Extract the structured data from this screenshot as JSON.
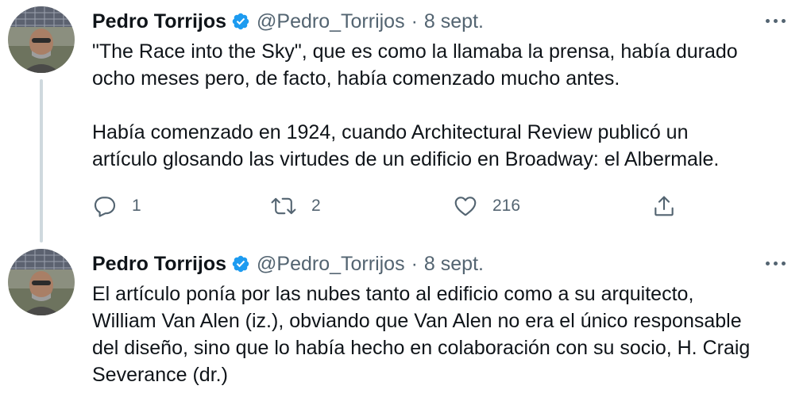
{
  "tweets": [
    {
      "author": {
        "name": "Pedro Torrijos",
        "handle": "@Pedro_Torrijos",
        "verified": true
      },
      "separator": "·",
      "date": "8 sept.",
      "text_lines": [
        "\"The Race into the Sky\", que es como la llamaba la prensa, había durado",
        "ocho meses pero, de facto, había comenzado mucho antes.",
        "Había comenzado en 1924, cuando Architectural Review publicó un",
        "artículo glosando las virtudes de un edificio en Broadway: el Albermale."
      ],
      "actions": {
        "replies": "1",
        "retweets": "2",
        "likes": "216"
      }
    },
    {
      "author": {
        "name": "Pedro Torrijos",
        "handle": "@Pedro_Torrijos",
        "verified": true
      },
      "separator": "·",
      "date": "8 sept.",
      "text_lines": [
        "El artículo ponía por las nubes tanto al edificio como a su arquitecto,",
        "William Van Alen (iz.), obviando que Van Alen no era el único responsable",
        "del diseño, sino que lo había hecho en colaboración con su socio, H. Craig",
        "Severance (dr.)"
      ]
    }
  ],
  "icons": {
    "verified": "verified-badge-icon",
    "more": "more-horizontal-icon",
    "reply": "reply-icon",
    "retweet": "retweet-icon",
    "like": "heart-icon",
    "share": "share-icon"
  },
  "colors": {
    "text": "#0f1419",
    "secondary": "#536471",
    "verified": "#1d9bf0",
    "thread_line": "#cfd9de"
  }
}
